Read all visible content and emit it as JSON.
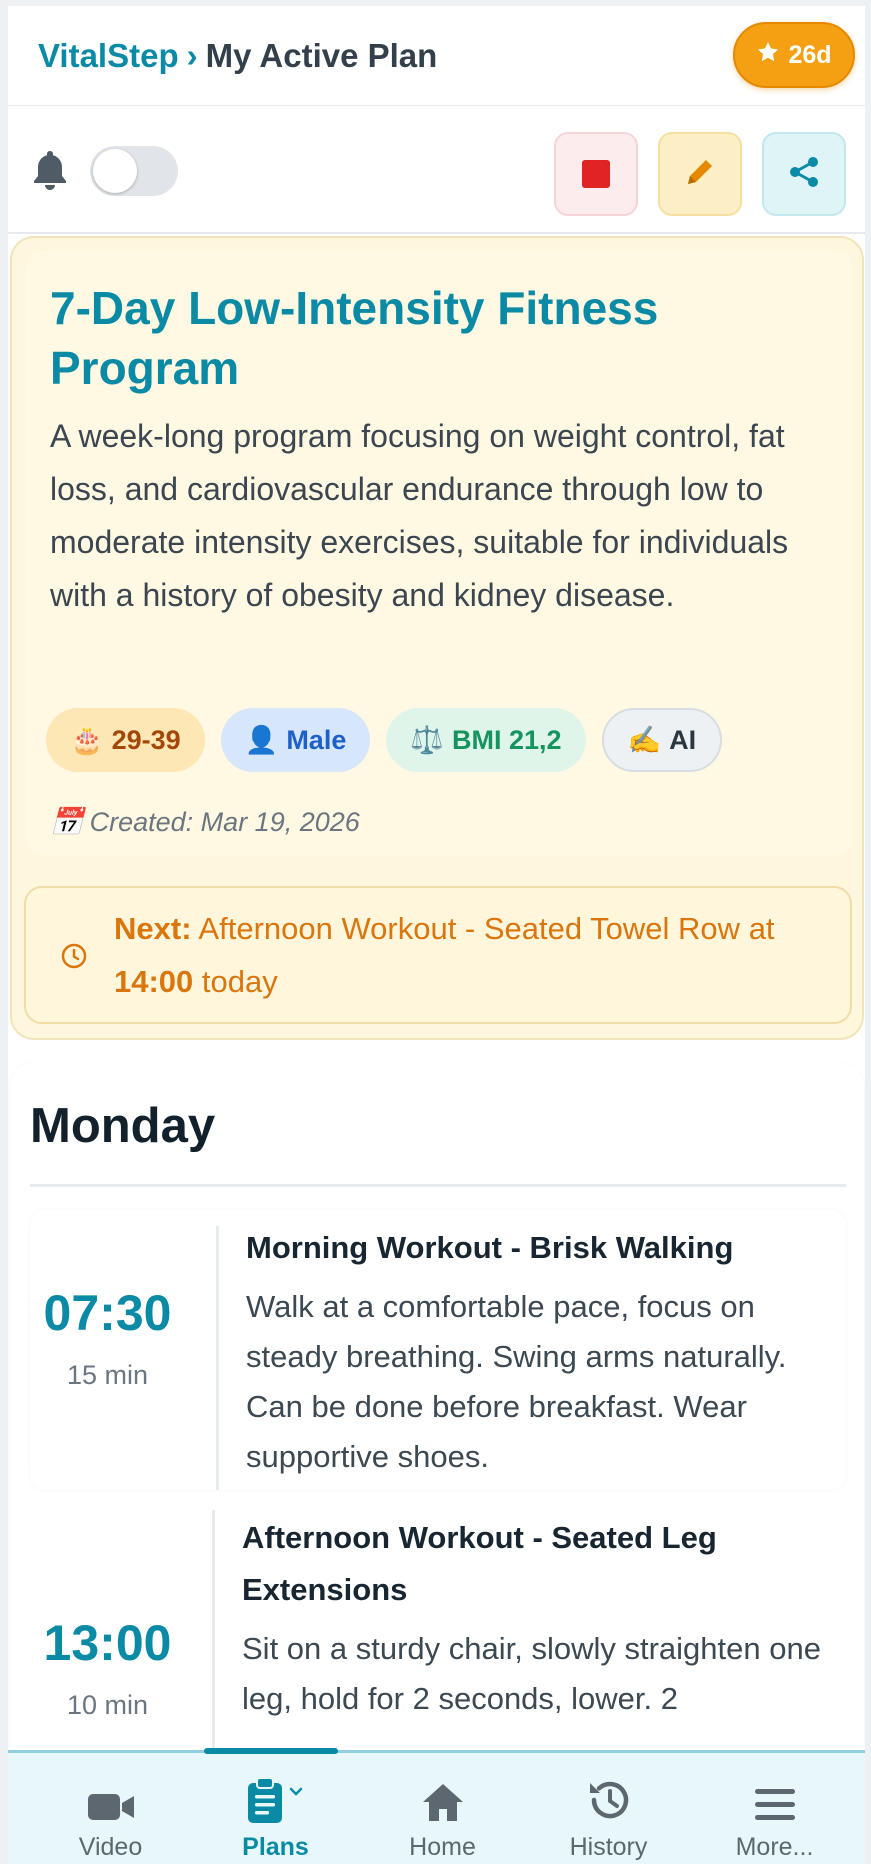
{
  "header": {
    "brand": "VitalStep",
    "separator": "›",
    "current": "My Active Plan",
    "streak_label": "26d"
  },
  "toolbar": {
    "notifications_enabled": false
  },
  "plan": {
    "title": "7-Day Low-Intensity Fitness Program",
    "description": "A week-long program focusing on weight control, fat loss, and cardiovascular endurance through low to moderate intensity exercises, suitable for individuals with a history of obesity and kidney disease.",
    "tags": {
      "age": {
        "emoji": "🎂",
        "label": "29-39"
      },
      "gender": {
        "emoji": "👤",
        "label": "Male"
      },
      "bmi": {
        "emoji": "⚖️",
        "label": "BMI 21,2"
      },
      "source": {
        "emoji": "✍️",
        "label": "AI"
      }
    },
    "created_emoji": "📅",
    "created": "Created: Mar 19, 2026",
    "next": {
      "prefix": "Next:",
      "activity": "Afternoon Workout - Seated Towel Row",
      "at": "at",
      "time": "14:00",
      "when": "today"
    }
  },
  "day": {
    "title": "Monday",
    "sessions": [
      {
        "time": "07:30",
        "duration": "15 min",
        "title": "Morning Workout - Brisk Walking",
        "description": "Walk at a comfortable pace, focus on steady breathing. Swing arms naturally. Can be done before breakfast. Wear supportive shoes."
      },
      {
        "time": "13:00",
        "duration": "10 min",
        "title": "Afternoon Workout - Seated Leg Extensions",
        "description": "Sit on a sturdy chair, slowly straighten one leg, hold for 2 seconds, lower. 2"
      }
    ]
  },
  "nav": {
    "items": [
      {
        "label": "Video",
        "icon": "video-camera-icon"
      },
      {
        "label": "Plans",
        "icon": "clipboard-icon"
      },
      {
        "label": "Home",
        "icon": "home-icon"
      },
      {
        "label": "History",
        "icon": "history-icon"
      },
      {
        "label": "More...",
        "icon": "menu-icon"
      }
    ],
    "active": "Plans"
  },
  "colors": {
    "accent": "#0a8aa5",
    "streak": "#f5a012",
    "stop": "#e02424",
    "next_text": "#d9760d"
  }
}
